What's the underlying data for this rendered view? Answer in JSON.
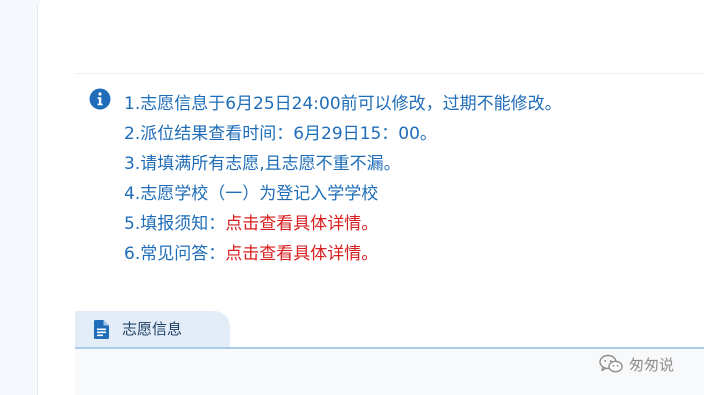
{
  "notice": {
    "icon": "info-circle-icon",
    "icon_color": "#1f6db8",
    "items": [
      "1.志愿信息于6月25日24:00前可以修改，过期不能修改。",
      "2.派位结果查看时间：6月29日15：00。",
      "3.请填满所有志愿,且志愿不重不漏。",
      "4.志愿学校（一）为登记入学学校"
    ],
    "guide_label": "5.填报须知：",
    "guide_link": "点击查看具体详情。",
    "faq_label": "6.常见问答：",
    "faq_link": "点击查看具体详情。",
    "link_color": "#d81e1e"
  },
  "tab": {
    "icon": "document-icon",
    "label": "志愿信息"
  },
  "watermark": {
    "icon": "wechat-icon",
    "text": "匆匆说"
  }
}
